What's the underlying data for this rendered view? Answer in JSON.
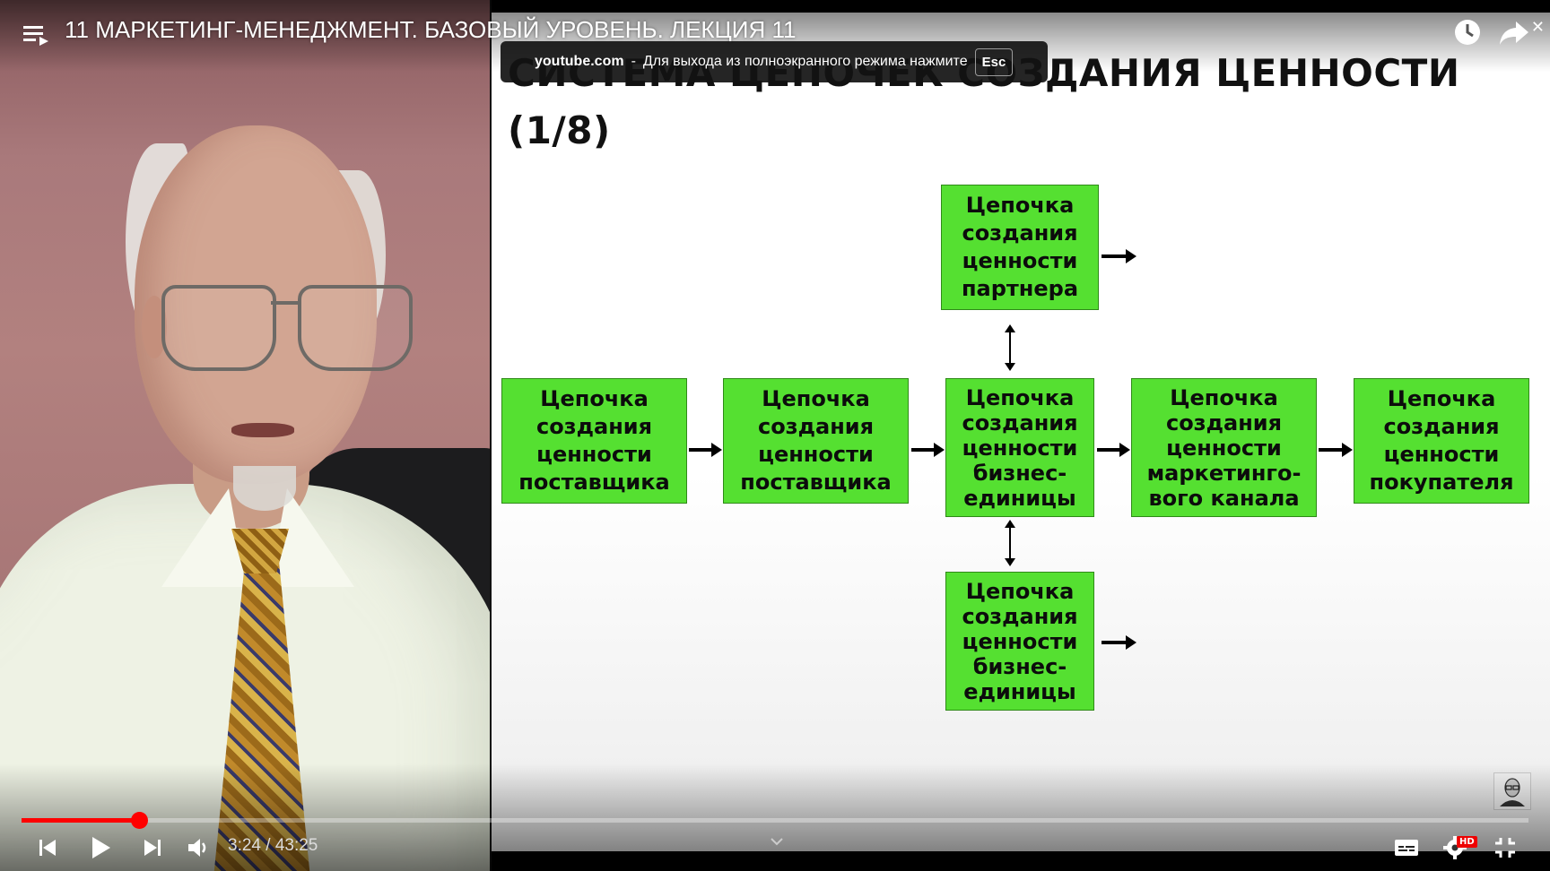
{
  "player": {
    "title": "11 МАРКЕТИНГ-МЕНЕДЖМЕНТ. БАЗОВЫЙ УРОВЕНЬ. ЛЕКЦИЯ 11",
    "current_time": "3:24",
    "duration": "43:25",
    "time_display": "3:24 / 43:25",
    "progress_fraction": 0.078,
    "hd_label": "HD",
    "accent_color": "#ff0000"
  },
  "fullscreen_notice": {
    "domain": "youtube.com",
    "separator": "-",
    "message": "Для выхода из полноэкранного режима нажмите",
    "key": "Esc"
  },
  "slide": {
    "title_line1": "СИСТЕМА ЦЕПОЧЕК СОЗДАНИЯ ЦЕННОСТИ",
    "title_line2": "(1/8)",
    "box_color": "#55e031",
    "boxes": {
      "supplier1": "Цепочка\nсоздания\nценности\nпоставщика",
      "supplier2": "Цепочка\nсоздания\nценности\nпоставщика",
      "partner": "Цепочка\nсоздания\nценности\nпартнера",
      "business_unit": "Цепочка\nсоздания\nценности\nбизнес-\nединицы",
      "business_unit2": "Цепочка\nсоздания\nценности\nбизнес-\nединицы",
      "channel": "Цепочка\nсоздания\nценности\nмаркетинго-\nвого канала",
      "customer": "Цепочка\nсоздания\nценности\nпокупателя"
    }
  },
  "icons": {
    "playlist": "playlist-icon",
    "watch_later": "clock-icon",
    "share": "share-icon",
    "close": "close-icon",
    "prev": "skip-previous-icon",
    "play": "play-icon",
    "next": "skip-next-icon",
    "volume": "volume-icon",
    "subtitles": "subtitles-icon",
    "settings": "gear-icon",
    "exit_fullscreen": "exit-fullscreen-icon",
    "chevron": "chevron-down-icon"
  }
}
